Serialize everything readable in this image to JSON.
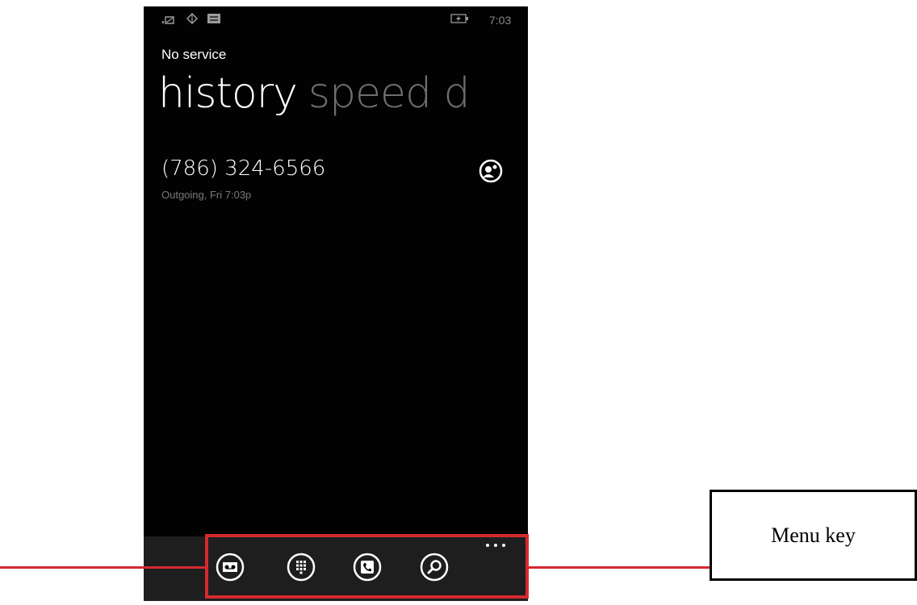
{
  "status_bar": {
    "icons": [
      "signal-icon",
      "data-connection-icon",
      "message-icon",
      "battery-charging-icon"
    ],
    "time": "7:03"
  },
  "carrier": "No service",
  "pivot": {
    "active": "history",
    "next": "speed d"
  },
  "call_history": [
    {
      "number": "(786) 324-6566",
      "detail": "Outgoing, Fri 7:03p",
      "action_icon": "contact-icon"
    }
  ],
  "app_bar": {
    "buttons": [
      {
        "icon": "voicemail-icon"
      },
      {
        "icon": "keypad-icon"
      },
      {
        "icon": "call-icon"
      },
      {
        "icon": "search-icon"
      }
    ],
    "menu": "..."
  },
  "annotation": {
    "callout_label": "Menu key",
    "color": "#d42a2f"
  }
}
